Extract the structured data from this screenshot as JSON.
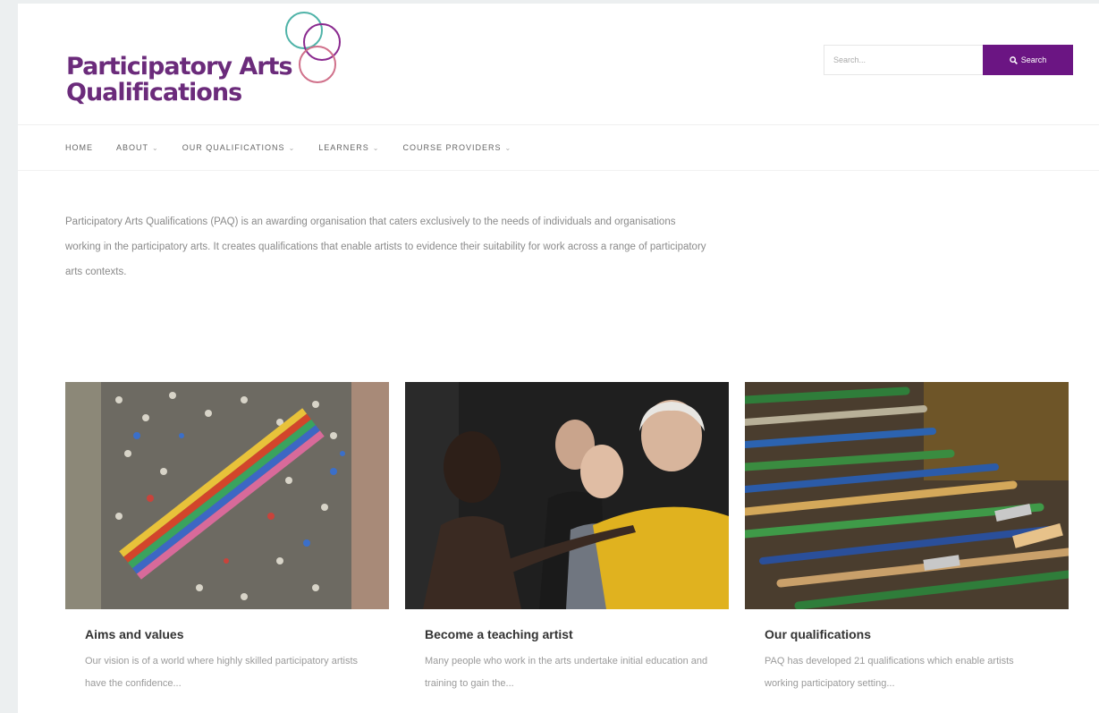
{
  "logo": {
    "line1": "Participatory Arts",
    "line2": "Qualifications"
  },
  "search": {
    "placeholder": "Search...",
    "button_label": "Search"
  },
  "nav": [
    {
      "label": "HOME",
      "has_menu": false
    },
    {
      "label": "ABOUT",
      "has_menu": true
    },
    {
      "label": "OUR QUALIFICATIONS",
      "has_menu": true
    },
    {
      "label": "LEARNERS",
      "has_menu": true
    },
    {
      "label": "COURSE PROVIDERS",
      "has_menu": true
    }
  ],
  "intro": "Participatory Arts Qualifications (PAQ) is an awarding organisation that caters exclusively to the needs of individuals and organisations working in the participatory arts. It creates qualifications that enable artists to evidence their suitability for work across a range of participatory arts contexts.",
  "cards": [
    {
      "title": "Aims and values",
      "text": "Our vision is of a world where highly skilled participatory artists have the confidence..."
    },
    {
      "title": "Become a teaching artist",
      "text": "Many people who work in the arts undertake initial education and training to gain the..."
    },
    {
      "title": "Our qualifications",
      "text": "PAQ has developed 21 qualifications which enable artists working participatory setting..."
    }
  ],
  "colors": {
    "brand_purple": "#6b1583",
    "logo_text": "#6b2b7b",
    "ring_teal": "#4fb3a8",
    "ring_purple": "#8a2a8f",
    "ring_pink": "#d0708a"
  }
}
